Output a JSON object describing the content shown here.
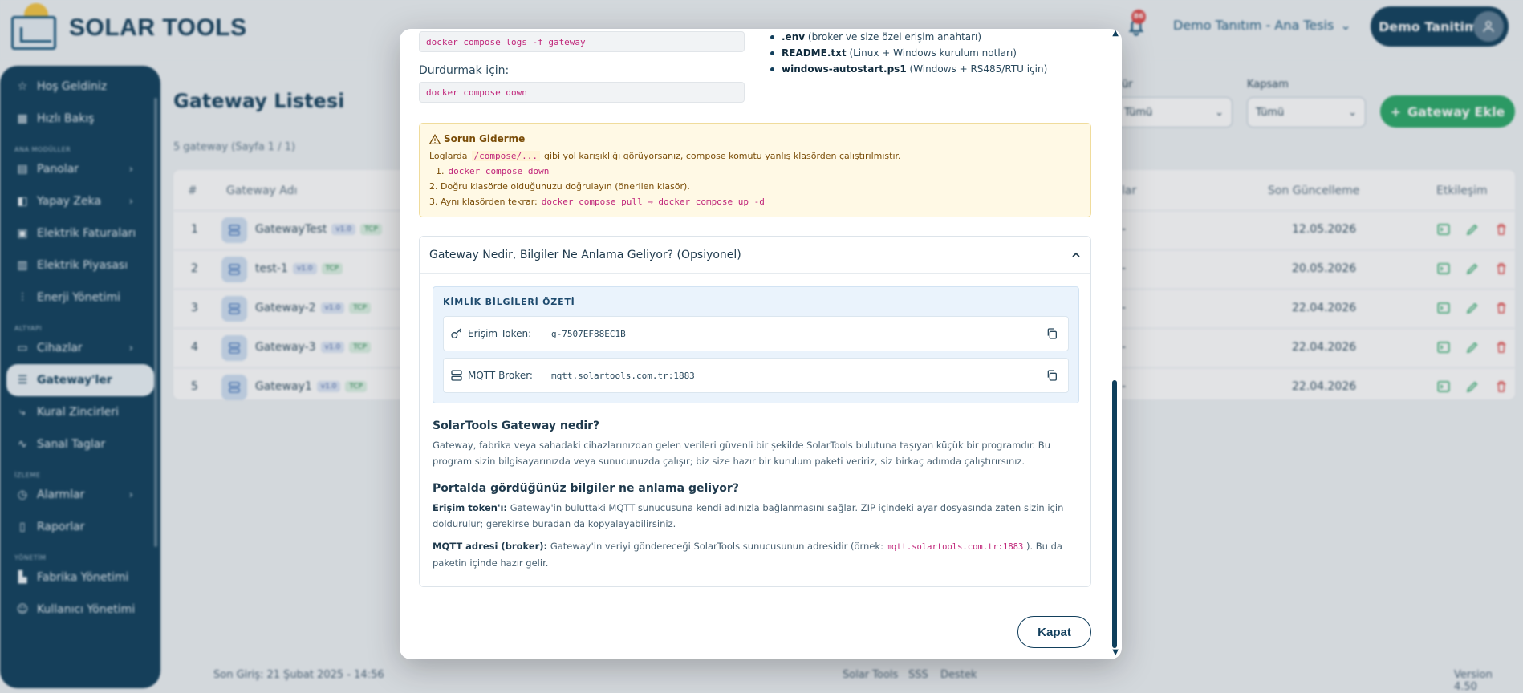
{
  "app": {
    "logo_text": "SOLAR TOOLS",
    "notification_count": "86",
    "tenant": "Demo Tanıtım - Ana Tesis",
    "user": "Demo Tanitim"
  },
  "sidebar": {
    "top_items": [
      {
        "label": "Hoş Geldiniz",
        "icon": "star-icon"
      },
      {
        "label": "Hızlı Bakış",
        "icon": "grid-icon"
      }
    ],
    "sections": {
      "main_modules": "ANA MODÜLLER",
      "infrastructure": "ALTYAPI",
      "monitoring": "İZLEME",
      "management": "YÖNETİM"
    },
    "main_items": [
      {
        "label": "Panolar",
        "icon": "dashboard-icon",
        "has_children": true
      },
      {
        "label": "Yapay Zeka",
        "icon": "ai-icon",
        "has_children": true
      },
      {
        "label": "Elektrik Faturaları",
        "icon": "bill-icon"
      },
      {
        "label": "Elektrik Piyasası",
        "icon": "market-icon"
      },
      {
        "label": "Enerji Yönetimi",
        "icon": "sliders-icon"
      }
    ],
    "infra_items": [
      {
        "label": "Cihazlar",
        "icon": "monitor-icon",
        "has_children": true
      },
      {
        "label": "Gateway'ler",
        "icon": "server-icon",
        "active": true
      },
      {
        "label": "Kural Zincirleri",
        "icon": "flow-icon"
      },
      {
        "label": "Sanal Taglar",
        "icon": "pulse-icon"
      }
    ],
    "monitor_items": [
      {
        "label": "Alarmlar",
        "icon": "alarm-icon",
        "has_children": true
      },
      {
        "label": "Raporlar",
        "icon": "report-icon"
      }
    ],
    "manage_items": [
      {
        "label": "Fabrika Yönetimi",
        "icon": "factory-icon"
      },
      {
        "label": "Kullanıcı Yönetimi",
        "icon": "users-icon"
      }
    ]
  },
  "page": {
    "title": "Gateway Listesi",
    "subtitle": "5 gateway (Sayfa 1 / 1)",
    "filter_partial_label": "ür",
    "filter1_value": "Tümü",
    "filter2_label": "Kapsam",
    "filter2_value": "Tümü",
    "add_button": "Gateway Ekle"
  },
  "table": {
    "headers": {
      "index": "#",
      "name": "Gateway Adı",
      "partial": "lar",
      "updated": "Son Güncelleme",
      "actions": "Etkileşim"
    },
    "rows": [
      {
        "index": "1",
        "name": "GatewayTest",
        "version": "v1.0",
        "protocol": "TCP",
        "dash": "-",
        "updated": "12.05.2026"
      },
      {
        "index": "2",
        "name": "test-1",
        "version": "v1.0",
        "protocol": "TCP",
        "dash": "-",
        "updated": "20.05.2026"
      },
      {
        "index": "3",
        "name": "Gateway-2",
        "version": "v1.0",
        "protocol": "TCP",
        "dash": "-",
        "updated": "22.04.2026"
      },
      {
        "index": "4",
        "name": "Gateway-3",
        "version": "v1.0",
        "protocol": "TCP",
        "dash": "-",
        "updated": "22.04.2026"
      },
      {
        "index": "5",
        "name": "Gateway1",
        "version": "v1.0",
        "protocol": "TCP",
        "dash": "-",
        "updated": "22.04.2026"
      }
    ]
  },
  "footer": {
    "last_login": "Son Giriş: 21 Şubat 2025 - 14:56",
    "link1": "Solar Tools",
    "link2": "SSS",
    "link3": "Destek",
    "version": "Version 4.50"
  },
  "modal": {
    "logs_cmd": "docker compose logs -f gateway",
    "stop_label": "Durdurmak için:",
    "stop_cmd": "docker compose down",
    "files": [
      {
        "name": ".env",
        "desc": "(broker ve size özel erişim anahtarı)"
      },
      {
        "name": "README.txt",
        "desc": "(Linux + Windows kurulum notları)"
      },
      {
        "name": "windows-autostart.ps1",
        "desc": "(Windows + RS485/RTU için)"
      }
    ],
    "warning": {
      "title": "Sorun Giderme",
      "line1_pre": "Loglarda",
      "line1_code": "/compose/...",
      "line1_post": "gibi yol karışıklığı görüyorsanız, compose komutu yanlış klasörden çalıştırılmıştır.",
      "step1_no": "1.",
      "step1_code": "docker compose down",
      "step2": "2. Doğru klasörde olduğunuzu doğrulayın (önerilen klasör).",
      "step3_pre": "3. Aynı klasörden tekrar:",
      "step3_code": "docker compose pull → docker compose up -d"
    },
    "accordion_title": "Gateway Nedir, Bilgiler Ne Anlama Geliyor? (Opsiyonel)",
    "id_summary_title": "KİMLİK BİLGİLERİ ÖZETİ",
    "token_label": "Erişim Token:",
    "token_value": "g-7507EF88EC1B",
    "broker_label": "MQTT Broker:",
    "broker_value": "mqtt.solartools.com.tr:1883",
    "what_title": "SolarTools Gateway nedir?",
    "what_text": "Gateway, fabrika veya sahadaki cihazlarınızdan gelen verileri güvenli bir şekilde SolarTools bulutuna taşıyan küçük bir programdır. Bu program sizin bilgisayarınızda veya sunucunuzda çalışır; biz size hazır bir kurulum paketi veririz, siz birkaç adımda çalıştırırsınız.",
    "meaning_title": "Portalda gördüğünüz bilgiler ne anlama geliyor?",
    "token_term": "Erişim token'ı:",
    "token_text": "Gateway'in buluttaki MQTT sunucusuna kendi adınızla bağlanmasını sağlar. ZIP içindeki ayar dosyasında zaten sizin için doldurulur; gerekirse buradan da kopyalayabilirsiniz.",
    "broker_term": "MQTT adresi (broker):",
    "broker_text_pre": "Gateway'in veriyi göndereceği SolarTools sunucusunun adresidir (örnek:",
    "broker_text_code": "mqtt.solartools.com.tr:1883",
    "broker_text_post": "). Bu da paketin içinde hazır gelir.",
    "close_button": "Kapat"
  }
}
